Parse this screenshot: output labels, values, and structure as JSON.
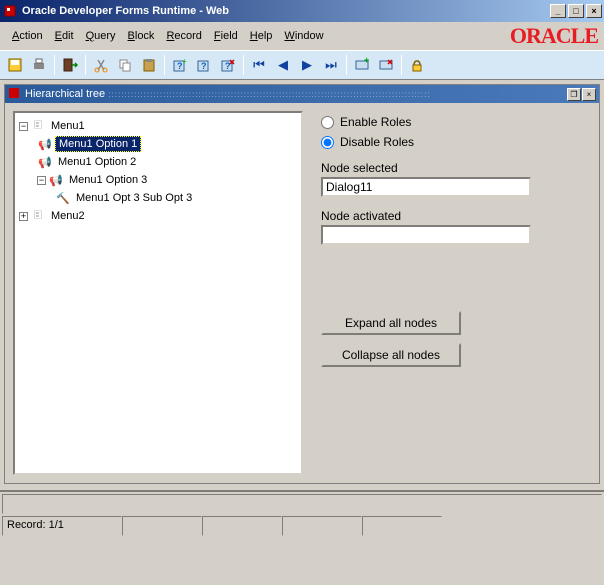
{
  "window": {
    "title": "Oracle Developer Forms Runtime - Web",
    "brand": "ORACLE"
  },
  "menubar": {
    "items": [
      {
        "label": "Action",
        "key": "A"
      },
      {
        "label": "Edit",
        "key": "E"
      },
      {
        "label": "Query",
        "key": "Q"
      },
      {
        "label": "Block",
        "key": "B"
      },
      {
        "label": "Record",
        "key": "R"
      },
      {
        "label": "Field",
        "key": "F"
      },
      {
        "label": "Help",
        "key": "H"
      },
      {
        "label": "Window",
        "key": "W"
      }
    ]
  },
  "toolbar": {
    "icons": [
      "save",
      "print",
      "|",
      "exit",
      "|",
      "cut",
      "copy",
      "paste",
      "|",
      "create",
      "find",
      "remove",
      "|",
      "first",
      "prev",
      "next",
      "last",
      "|",
      "insert",
      "delete",
      "|",
      "lock"
    ]
  },
  "inner": {
    "title": "Hierarchical tree"
  },
  "tree": {
    "nodes": [
      {
        "id": "menu1",
        "label": "Menu1",
        "level": 0,
        "expanded": true,
        "icon": "folder",
        "children": true
      },
      {
        "id": "m1o1",
        "label": "Menu1 Option 1",
        "level": 1,
        "icon": "leaf",
        "selected": true
      },
      {
        "id": "m1o2",
        "label": "Menu1 Option 2",
        "level": 1,
        "icon": "leaf"
      },
      {
        "id": "m1o3",
        "label": "Menu1 Option 3",
        "level": 1,
        "expanded": true,
        "icon": "leaf",
        "children": true
      },
      {
        "id": "m1o3s3",
        "label": "Menu1 Opt 3 Sub Opt 3",
        "level": 2,
        "icon": "tool"
      },
      {
        "id": "menu2",
        "label": "Menu2",
        "level": 0,
        "expanded": false,
        "icon": "folder",
        "children": true
      }
    ]
  },
  "options": {
    "enable_roles_label": "Enable Roles",
    "disable_roles_label": "Disable Roles",
    "roles_selected": "disable",
    "node_selected_label": "Node selected",
    "node_selected_value": "Dialog11",
    "node_activated_label": "Node activated",
    "node_activated_value": "",
    "expand_btn": "Expand all nodes",
    "collapse_btn": "Collapse all nodes"
  },
  "status": {
    "record": "Record: 1/1"
  }
}
